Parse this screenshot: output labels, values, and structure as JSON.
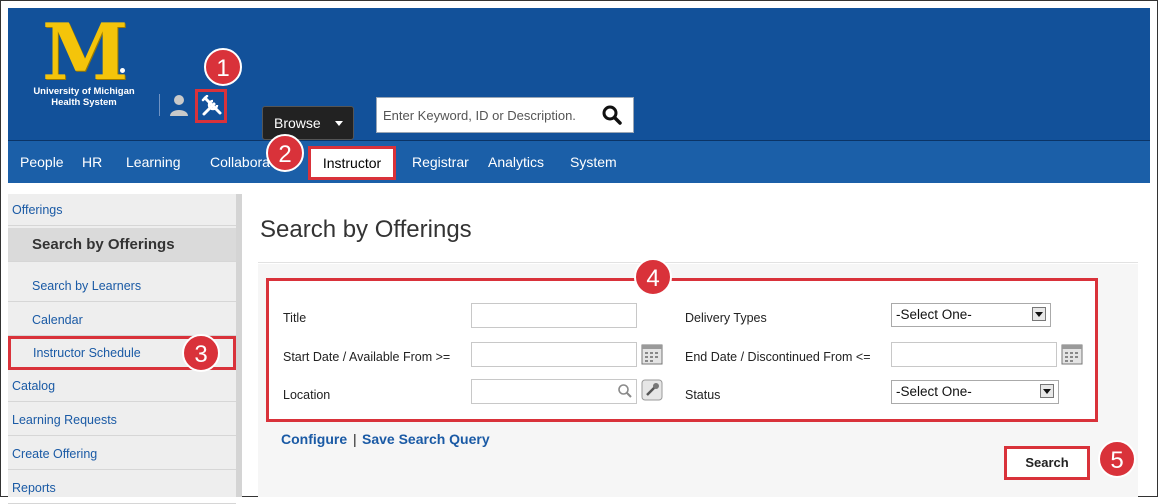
{
  "header": {
    "logo_letter": "M",
    "logo_text_line1": "University of Michigan",
    "logo_text_line2": "Health System",
    "browse_label": "Browse",
    "search_placeholder": "Enter Keyword, ID or Description."
  },
  "nav": {
    "items": [
      "People",
      "HR",
      "Learning",
      "Collabora",
      "Instructor",
      "Registrar",
      "Analytics",
      "System"
    ],
    "active": "Instructor"
  },
  "sidebar": {
    "items": [
      {
        "label": "Offerings",
        "level": 1
      },
      {
        "label": "Search by Offerings",
        "level": 2,
        "active": true
      },
      {
        "label": "Search by Learners",
        "level": 2
      },
      {
        "label": "Calendar",
        "level": 2
      },
      {
        "label": "Instructor Schedule",
        "level": 2,
        "highlighted": true
      },
      {
        "label": "Catalog",
        "level": 1
      },
      {
        "label": "Learning Requests",
        "level": 1
      },
      {
        "label": "Create Offering",
        "level": 1
      },
      {
        "label": "Reports",
        "level": 1
      }
    ]
  },
  "main": {
    "title": "Search by Offerings",
    "form": {
      "title_label": "Title",
      "start_date_label": "Start Date / Available From >=",
      "location_label": "Location",
      "delivery_types_label": "Delivery Types",
      "end_date_label": "End Date / Discontinued From <=",
      "status_label": "Status",
      "delivery_types_value": "-Select One-",
      "status_value": "-Select One-"
    },
    "configure_link": "Configure",
    "separator": "|",
    "save_query_link": "Save Search Query",
    "search_button": "Search"
  },
  "badges": [
    "1",
    "2",
    "3",
    "4",
    "5"
  ],
  "colors": {
    "header_blue": "#12519a",
    "nav_blue": "#1b5fa8",
    "logo_maize": "#f4c40a",
    "highlight_red": "#d9323a",
    "link_blue": "#1a5aa5"
  },
  "icons": [
    "person-icon",
    "tools-icon",
    "search-icon",
    "calendar-icon",
    "magnifier-icon",
    "clear-icon",
    "chevron-down-icon"
  ]
}
